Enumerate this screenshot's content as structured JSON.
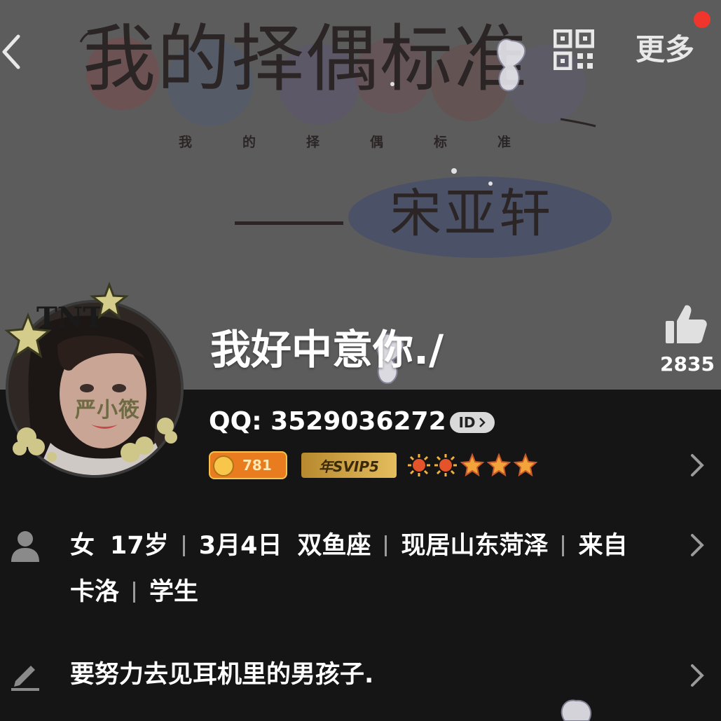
{
  "header": {
    "more_label": "更多",
    "notification_color": "#f0352c",
    "icons": [
      "back-icon",
      "qr-code-icon"
    ]
  },
  "cover": {
    "title": "我的择偶标准",
    "subtitle": "我的择偶标准",
    "name": "宋亚轩"
  },
  "profile": {
    "nickname": "我好中意你./",
    "likes": "2835",
    "qq_label": "QQ:",
    "qq_number": "3529036272",
    "id_badge": "ID",
    "avatar_text": "严小筱",
    "avatar_badge": "TNT",
    "coin_level": "781",
    "svip_label": "年SVIP5",
    "level_icons": [
      "sun",
      "sun",
      "star",
      "star",
      "star"
    ]
  },
  "info": {
    "gender": "女",
    "age": "17岁",
    "birthday": "3月4日",
    "zodiac": "双鱼座",
    "location": "现居山东菏泽",
    "from_label": "来自",
    "from_place": "卡洛",
    "job": "学生"
  },
  "signature": {
    "text": "要努力去见耳机里的男孩子."
  }
}
